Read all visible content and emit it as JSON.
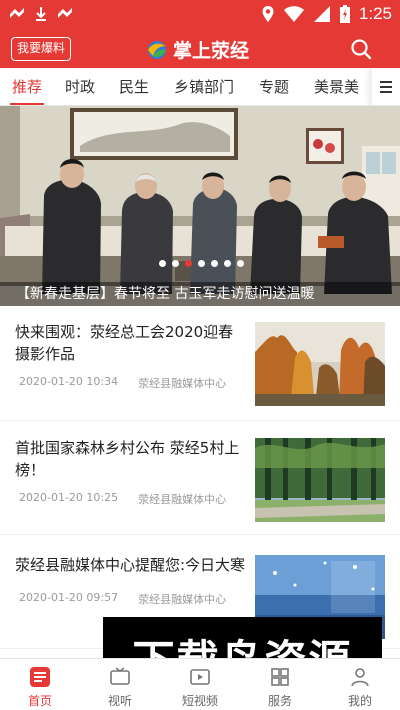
{
  "status": {
    "time": "1:25"
  },
  "header": {
    "report_label": "我要爆料",
    "title": "掌上荥经"
  },
  "tabs": [
    {
      "label": "推荐"
    },
    {
      "label": "时政"
    },
    {
      "label": "民生"
    },
    {
      "label": "乡镇部门"
    },
    {
      "label": "专题"
    },
    {
      "label": "美景美"
    }
  ],
  "banner": {
    "caption": "【新春走基层】春节将至 古玉军走访慰问送温暖",
    "slide_count": 7,
    "active_slide": 2
  },
  "news": [
    {
      "title": "快来围观：荥经总工会2020迎春摄影作品",
      "date": "2020-01-20 10:34",
      "source": "荥经县融媒体中心"
    },
    {
      "title": "首批国家森林乡村公布 荥经5村上榜！",
      "date": "2020-01-20 10:25",
      "source": "荥经县融媒体中心"
    },
    {
      "title": "荥经县融媒体中心提醒您:今日大寒",
      "date": "2020-01-20 09:57",
      "source": "荥经县融媒体中心"
    }
  ],
  "watermark": "下载鸟资源",
  "bottom_nav": [
    {
      "label": "首页",
      "active": true
    },
    {
      "label": "视听"
    },
    {
      "label": "短视频"
    },
    {
      "label": "服务"
    },
    {
      "label": "我的"
    }
  ],
  "colors": {
    "accent": "#e53935"
  }
}
